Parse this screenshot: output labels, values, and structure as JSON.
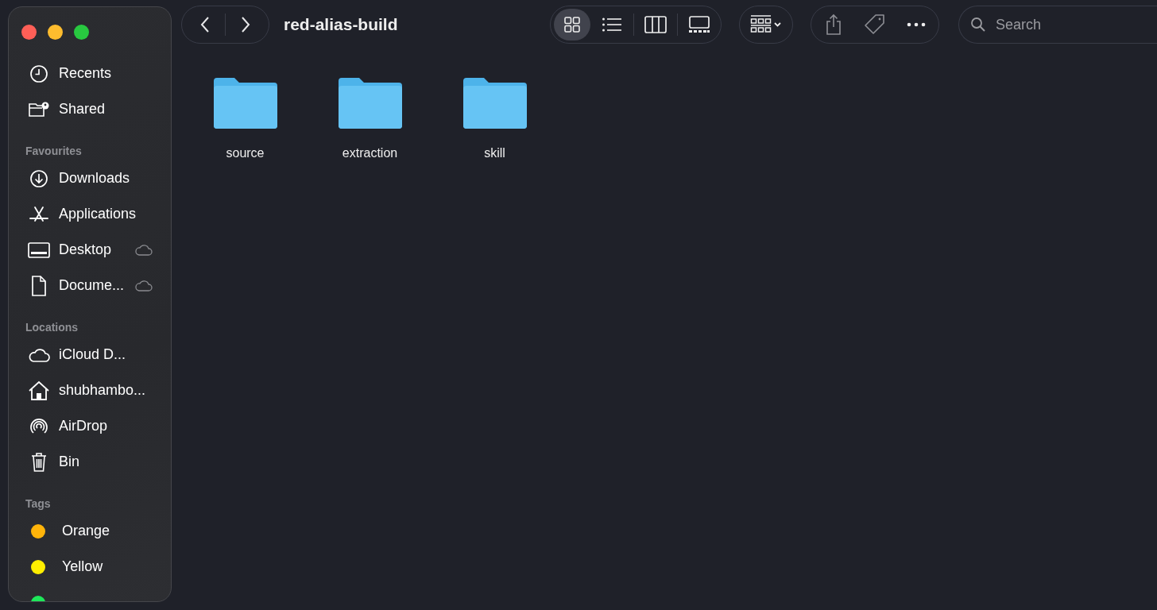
{
  "sidebar": {
    "sections": [
      {
        "items": [
          {
            "label": "Recents",
            "cloud": false
          },
          {
            "label": "Shared",
            "cloud": false
          }
        ]
      },
      {
        "title": "Favourites",
        "items": [
          {
            "label": "Downloads",
            "cloud": false
          },
          {
            "label": "Applications",
            "cloud": false
          },
          {
            "label": "Desktop",
            "cloud": true
          },
          {
            "label": "Docume...",
            "cloud": true
          }
        ]
      },
      {
        "title": "Locations",
        "items": [
          {
            "label": "iCloud D...",
            "cloud": false
          },
          {
            "label": "shubhambo...",
            "cloud": false
          },
          {
            "label": "AirDrop",
            "cloud": false
          },
          {
            "label": "Bin",
            "cloud": false
          }
        ]
      }
    ],
    "tags": {
      "title": "Tags",
      "items": [
        {
          "label": "Orange",
          "color": "#ffb40a"
        },
        {
          "label": "Yellow",
          "color": "#ffee00"
        },
        {
          "color": "#1ee85a"
        }
      ]
    }
  },
  "toolbar": {
    "title": "red-alias-build",
    "view_modes": [
      {
        "selected": true
      },
      {
        "selected": false
      },
      {
        "selected": false
      },
      {
        "selected": false
      }
    ],
    "search": {
      "placeholder": "Search"
    }
  },
  "folders": [
    {
      "name": "source"
    },
    {
      "name": "extraction"
    },
    {
      "name": "skill"
    }
  ]
}
